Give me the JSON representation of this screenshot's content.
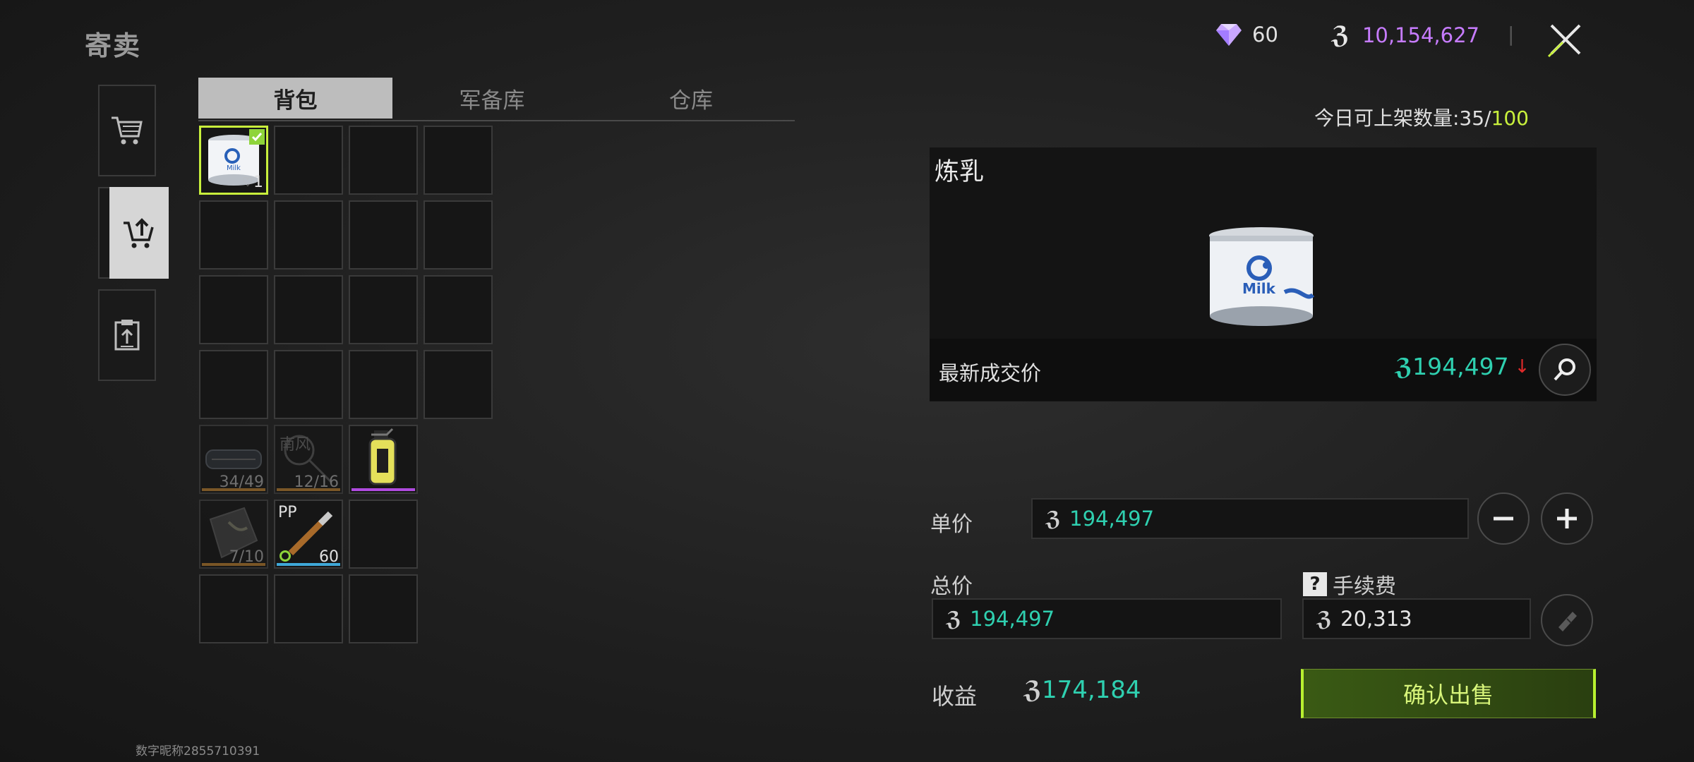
{
  "header": {
    "title": "寄卖",
    "gems": "60",
    "currency": "10,154,627",
    "divider": "|"
  },
  "tabs": [
    "背包",
    "军备库",
    "仓库"
  ],
  "inventory": {
    "selected_item_count": "1",
    "items": [
      {
        "name": "body-armor",
        "count": "34/49",
        "bar_color": "#9a6a2a"
      },
      {
        "name": "keys",
        "label": "南风",
        "count": "12/16",
        "bar_color": "#9a6a2a"
      },
      {
        "name": "grenade",
        "count": "",
        "bar_color": "#b04adf"
      },
      {
        "name": "map-package",
        "count": "7/10",
        "bar_color": "#9a6a2a"
      },
      {
        "name": "ammo",
        "label": "PP",
        "count": "60",
        "bar_color": "#3fa8d8"
      }
    ]
  },
  "listing": {
    "daily_limit_label": "今日可上架数量:35/",
    "daily_limit_max": "100",
    "item_name": "炼乳",
    "latest_price_label": "最新成交价",
    "latest_price": "194,497",
    "unit_price_label": "单价",
    "unit_price": "194,497",
    "total_label": "总价",
    "total": "194,497",
    "fee_label": "手续费",
    "fee": "20,313",
    "profit_label": "收益",
    "profit": "174,184",
    "confirm_label": "确认出售"
  },
  "footer": {
    "nickname": "数字昵称2855710391"
  },
  "colors": {
    "accent_green": "#c8f03c",
    "price_teal": "#2fd0b0",
    "currency_purple": "#c77cff"
  }
}
